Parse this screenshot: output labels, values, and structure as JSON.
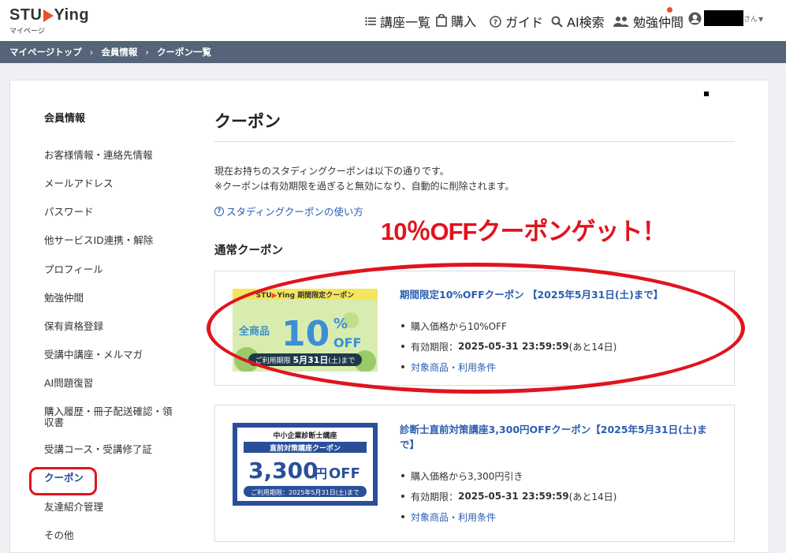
{
  "header": {
    "logo_text_a": "STU",
    "logo_text_b": "Ying",
    "logo_sub": "マイページ",
    "nav": [
      {
        "label": "講座一覧",
        "icon": "list-icon"
      },
      {
        "label": "購入",
        "icon": "shopping-bag-icon"
      },
      {
        "label": "ガイド",
        "icon": "help-circle-icon"
      },
      {
        "label": "AI検索",
        "icon": "search-icon"
      },
      {
        "label": "勉強仲間",
        "icon": "people-icon"
      }
    ],
    "user_suffix": "さん",
    "user_icon": "user-avatar-icon"
  },
  "breadcrumb": [
    "マイページトップ",
    "会員情報",
    "クーポン一覧"
  ],
  "sidebar": {
    "title": "会員情報",
    "items": [
      "お客様情報・連絡先情報",
      "メールアドレス",
      "パスワード",
      "他サービスID連携・解除",
      "プロフィール",
      "勉強仲間",
      "保有資格登録",
      "受講中講座・メルマガ",
      "AI問題復習",
      "購入履歴・冊子配送確認・領収書",
      "受講コース・受講修了証",
      "クーポン",
      "友達紹介管理",
      "その他"
    ],
    "active_index": 11
  },
  "main": {
    "title": "クーポン",
    "intro_1": "現在お持ちのスタディングクーポンは以下の通りです。",
    "intro_2": "※クーポンは有効期限を過ぎると無効になり、自動的に削除されます。",
    "howto_link": "スタディングクーポンの使い方",
    "promo_text": "10％OFFクーポンゲット！",
    "section_title": "通常クーポン"
  },
  "coupons": [
    {
      "title": "期間限定10%OFFクーポン 【2025年5月31日(土)まで】",
      "bullet_1": "購入価格から10%OFF",
      "bullet_2_label": "有効期限：",
      "bullet_2_date": "2025-05-31 23:59:59",
      "bullet_2_remain": " (あと14日)",
      "link": "対象商品・利用条件",
      "img_brand_a": "STU",
      "img_brand_b": "Ying",
      "img_header_suffix": "期間限定クーポン",
      "img_left": "全商品",
      "img_big": "10",
      "img_pct": "%",
      "img_off": "OFF",
      "img_footer_label": "ご利用期限",
      "img_footer_date": "5月31日",
      "img_footer_day": "(土)まで",
      "colors": {
        "bg": "#d9ecb0",
        "header": "#f5e55c",
        "big": "#3a8fd6",
        "footer": "#1e3a4a"
      }
    },
    {
      "title": "診断士直前対策講座3,300円OFFクーポン【2025年5月31日(土)まで】",
      "bullet_1": "購入価格から3,300円引き",
      "bullet_2_label": "有効期限：",
      "bullet_2_date": "2025-05-31 23:59:59",
      "bullet_2_remain": " (あと14日)",
      "link": "対象商品・利用条件",
      "img_line_1": "中小企業診断士講座",
      "img_line_2": "直前対策講座クーポン",
      "img_amount": "3,300",
      "img_yen": "円",
      "img_off": "OFF",
      "img_footer": "ご利用期限：2025年5月31日(土)まで",
      "colors": {
        "frame": "#2a4f9a",
        "inner": "#ffffff",
        "amount": "#2a4f9a"
      }
    }
  ]
}
